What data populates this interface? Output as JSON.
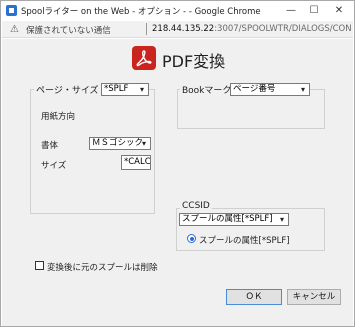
{
  "window": {
    "title": "Spoolライター on the Web - オプション - - Google Chrome",
    "minimize_glyph": "—",
    "maximize_glyph": "☐",
    "close_glyph": "✕"
  },
  "address": {
    "warning_glyph": "⚠",
    "insecure_label": "保護されていない通信",
    "host": "218.44.135.22",
    "path": ":3007/SPOOLWTR/DIALOGS/CON..."
  },
  "dialog": {
    "title": "PDF変換",
    "page_size": {
      "legend": "ページ・サイズ",
      "source_value": "*SPLF",
      "orientation_label": "用紙方向",
      "font_label": "書体",
      "font_value": "ＭＳゴシック",
      "size_label": "サイズ",
      "size_value": "*CALC"
    },
    "bookmark": {
      "legend": "Bookマーク",
      "value": "ページ番号"
    },
    "ccsid": {
      "legend": "CCSID",
      "select_value": "スプールの属性[*SPLF]",
      "radio_label": "スプールの属性[*SPLF]"
    },
    "delete_after_label": "変換後に元のスプールは削除",
    "ok_label": "ＯＫ",
    "cancel_label": "キャンセル"
  },
  "icons": {
    "dropdown": "▾"
  },
  "colors": {
    "pdf_red": "#c9241d",
    "radio_blue": "#2b6cd6"
  }
}
